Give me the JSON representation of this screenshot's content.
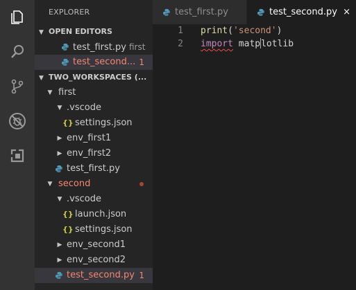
{
  "activity_bar": {
    "items": [
      {
        "icon": "files-icon"
      },
      {
        "icon": "search-icon"
      },
      {
        "icon": "source-control-icon"
      },
      {
        "icon": "debug-icon"
      },
      {
        "icon": "extensions-icon"
      }
    ]
  },
  "sidebar": {
    "title": "EXPLORER",
    "open_editors": {
      "header": "OPEN EDITORS",
      "items": [
        {
          "label": "test_first.py",
          "desc": "first"
        },
        {
          "label": "test_second...",
          "badge": "1"
        }
      ]
    },
    "workspace": {
      "header": "TWO_WORKSPACES (...",
      "tree": {
        "first": "first",
        "vscode1": ".vscode",
        "settings1": "settings.json",
        "env_first1": "env_first1",
        "env_first2": "env_first2",
        "test_first": "test_first.py",
        "second": "second",
        "vscode2": ".vscode",
        "launch": "launch.json",
        "settings2": "settings.json",
        "env_second1": "env_second1",
        "env_second2": "env_second2",
        "test_second": "test_second.py",
        "test_second_badge": "1"
      }
    }
  },
  "editor": {
    "tabs": [
      {
        "label": "test_first.py",
        "active": false
      },
      {
        "label": "test_second.py",
        "active": true
      }
    ],
    "close_glyph": "×",
    "lines": [
      {
        "number": "1",
        "fn": "print",
        "open": "(",
        "str": "'second'",
        "close": ")"
      },
      {
        "number": "2",
        "kw": "import",
        "before_cursor": " matp",
        "after_cursor": "lotlib"
      }
    ]
  },
  "colors": {
    "accent_error": "#f48771",
    "python_icon_blue": "#519aba",
    "json_icon_yellow": "#cbcb41"
  }
}
